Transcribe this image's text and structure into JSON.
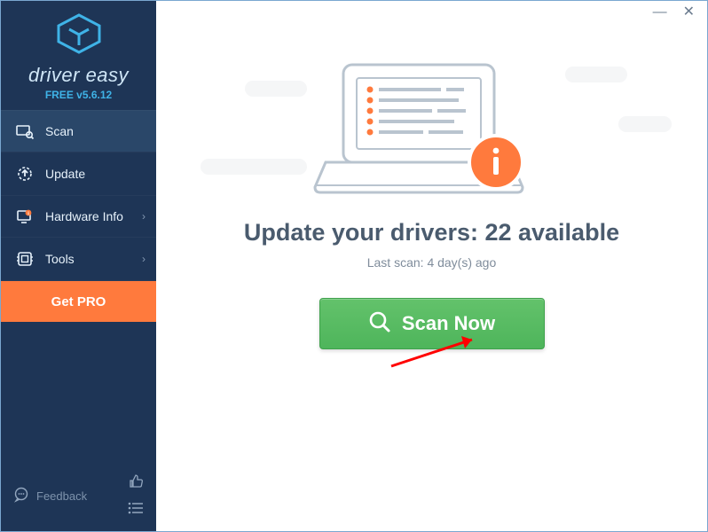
{
  "brand": {
    "name": "driver easy",
    "subline": "FREE v5.6.12"
  },
  "sidebar": {
    "items": [
      {
        "label": "Scan"
      },
      {
        "label": "Update"
      },
      {
        "label": "Hardware Info"
      },
      {
        "label": "Tools"
      }
    ],
    "pro_label": "Get PRO",
    "feedback_label": "Feedback"
  },
  "main": {
    "heading": "Update your drivers: 22 available",
    "subline": "Last scan: 4 day(s) ago",
    "scan_label": "Scan Now"
  }
}
